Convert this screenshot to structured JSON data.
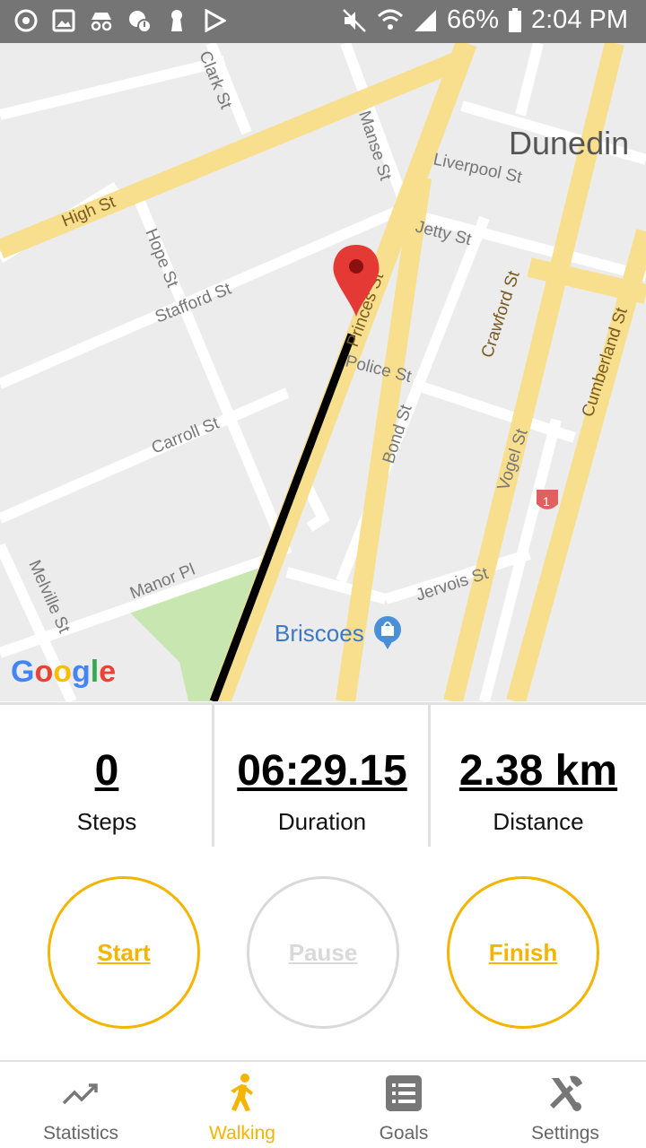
{
  "status_bar": {
    "icons": [
      "sync-icon",
      "gallery-icon",
      "incognito-icon",
      "chat-alert-icon",
      "keyhole-icon",
      "play-store-icon",
      "mute-icon",
      "wifi-icon",
      "signal-icon",
      "battery-icon"
    ],
    "battery": "66%",
    "time": "2:04 PM"
  },
  "map": {
    "city": "Dunedin",
    "streets": {
      "high": "High St",
      "clark": "Clark St",
      "manse": "Manse St",
      "liverpool": "Liverpool St",
      "jetty": "Jetty St",
      "hope": "Hope St",
      "stafford": "Stafford St",
      "princes": "Princes St",
      "crawford": "Crawford St",
      "cumberland": "Cumberland St",
      "police": "Police St",
      "carroll": "Carroll St",
      "bond": "Bond St",
      "vogel": "Vogel St",
      "manor": "Manor Pl",
      "jervois": "Jervois St",
      "melville": "Melville St"
    },
    "route_badge": "1",
    "poi": "Briscoes",
    "logo": "Google"
  },
  "stats": {
    "steps_value": "0",
    "steps_label": "Steps",
    "duration_value": "06:29.15",
    "duration_label": "Duration",
    "distance_value": "2.38 km",
    "distance_label": "Distance"
  },
  "controls": {
    "start": "Start",
    "pause": "Pause",
    "finish": "Finish"
  },
  "nav": {
    "statistics": "Statistics",
    "walking": "Walking",
    "goals": "Goals",
    "settings": "Settings",
    "active": "Walking"
  },
  "colors": {
    "accent": "#f4b400",
    "disabled": "#d9d9d9",
    "status_bar": "#757575",
    "pin": "#e53935"
  }
}
